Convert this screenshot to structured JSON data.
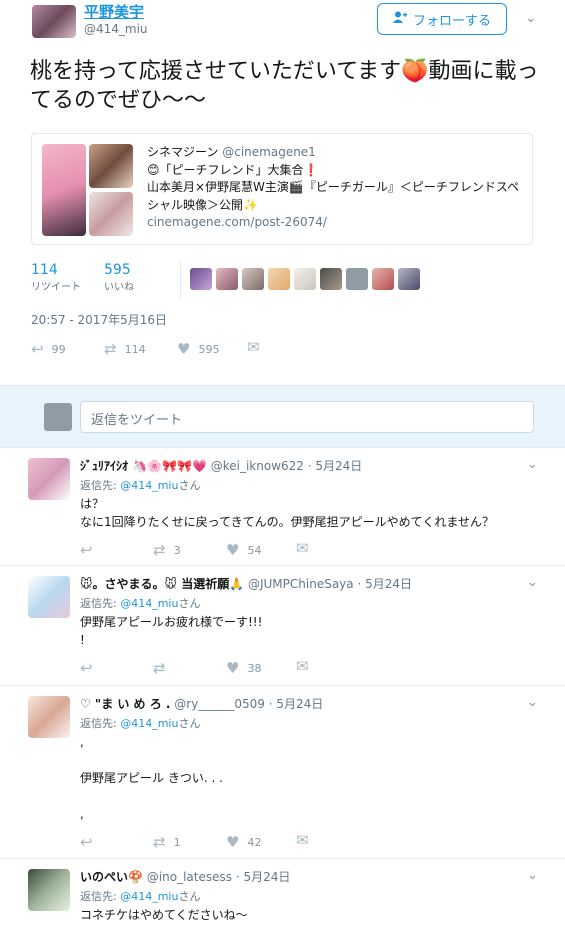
{
  "tweet": {
    "display_name": "平野美宇",
    "handle": "@414_miu",
    "follow_label": "フォローする",
    "text": "桃を持って応援させていただいてます🍑動画に載ってるのでぜひ〜〜",
    "card": {
      "source_name": "シネマジーン",
      "source_handle": "@cinemagene1",
      "line1": "😊「ピーチフレンド」大集合❗",
      "line2": "山本美月×伊野尾慧W主演🎬『ピーチガール』＜ピーチフレンドスペシャル映像＞公開✨",
      "url": "cinemagene.com/post-26074/"
    },
    "retweets_count": "114",
    "retweets_label": "リツイート",
    "likes_count": "595",
    "likes_label": "いいね",
    "timestamp": "20:57 - 2017年5月16日",
    "actions": {
      "reply": "99",
      "retweet": "114",
      "like": "595"
    }
  },
  "reply_box": {
    "placeholder": "返信をツイート"
  },
  "replies": [
    {
      "name": "ｼﾞｭﾘｱｲｼｵ 🦄🌸🎀🎀💗",
      "handle": "@kei_iknow622",
      "date": "· 5月24日",
      "to_prefix": "返信先: ",
      "to_handle": "@414_miu",
      "to_suffix": "さん",
      "body": "は？\nなに1回降りたくせに戻ってきてんの。伊野尾担アピールやめてくれません？",
      "retweets": "3",
      "likes": "54"
    },
    {
      "name": "🐭。さやまる。🐭 当選祈願🙏",
      "handle": "@JUMPChineSaya",
      "date": "· 5月24日",
      "to_prefix": "返信先: ",
      "to_handle": "@414_miu",
      "to_suffix": "さん",
      "body": "伊野尾アピールお疲れ様でーす!!!\n!",
      "retweets": "",
      "likes": "38"
    },
    {
      "name": "♡ \"ま い め ろ .",
      "handle": "@ry______0509",
      "date": "· 5月24日",
      "to_prefix": "返信先: ",
      "to_handle": "@414_miu",
      "to_suffix": "さん",
      "body": ",\n\n伊野尾アピール きつい. . .\n\n,",
      "retweets": "1",
      "likes": "42"
    },
    {
      "name": "いのぺい🍄",
      "handle": "@ino_latesess",
      "date": "· 5月24日",
      "to_prefix": "返信先: ",
      "to_handle": "@414_miu",
      "to_suffix": "さん",
      "body": "コネチケはやめてくださいね〜",
      "retweets": "",
      "likes": ""
    }
  ],
  "colors": {
    "accent": "#1b95e0",
    "reply_bar_bg": "#e8f4fb",
    "muted": "#657786"
  }
}
